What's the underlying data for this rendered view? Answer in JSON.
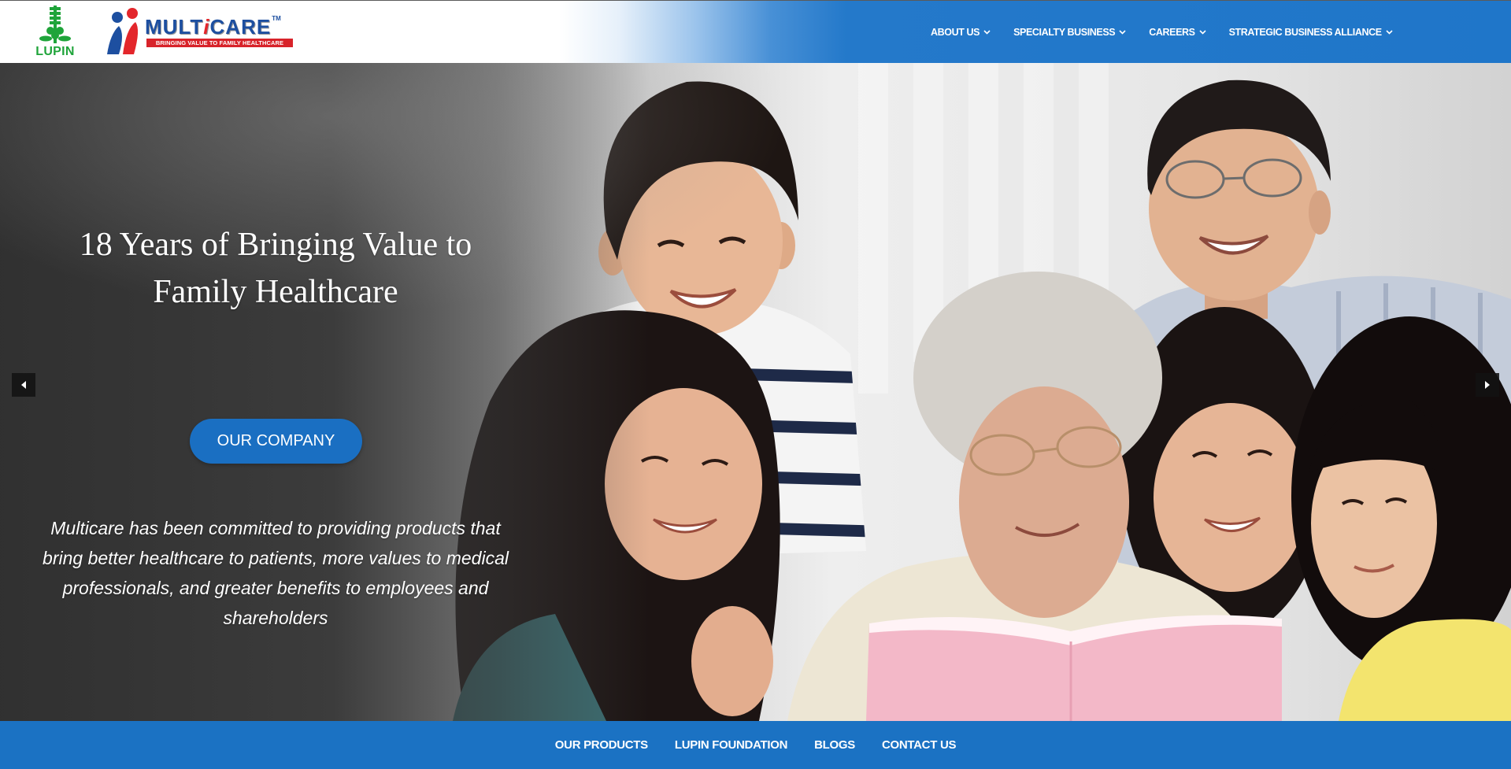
{
  "header": {
    "lupin_logo_text": "LUPIN",
    "multicare_logo": {
      "part1": "MULT",
      "part2": "i",
      "part3": "CARE",
      "tm": "TM",
      "tagline": "BRINGING VALUE TO FAMILY HEALTHCARE"
    },
    "nav": [
      {
        "label": "ABOUT US",
        "icon": "chevron-down-icon"
      },
      {
        "label": "SPECIALTY BUSINESS",
        "icon": "chevron-down-icon"
      },
      {
        "label": "CAREERS",
        "icon": "chevron-down-icon"
      },
      {
        "label": "STRATEGIC BUSINESS ALLIANCE",
        "icon": "chevron-down-icon"
      }
    ]
  },
  "hero": {
    "title_line1": "18 Years of Bringing Value to",
    "title_line2": "Family Healthcare",
    "cta_label": "OUR COMPANY",
    "description": "Multicare has been committed to providing products that bring better healthcare to patients, more values to medical professionals, and greater benefits to employees and shareholders",
    "prev_icon": "arrow-left-icon",
    "next_icon": "arrow-right-icon"
  },
  "footer_nav": [
    {
      "label": "OUR PRODUCTS"
    },
    {
      "label": "LUPIN FOUNDATION"
    },
    {
      "label": "BLOGS"
    },
    {
      "label": "CONTACT US"
    }
  ],
  "colors": {
    "brand_blue": "#1b72c3",
    "button_blue": "#1a6fc2",
    "lupin_green": "#1fa43a",
    "multicare_blue": "#1d4fa0",
    "multicare_red": "#e3262b"
  }
}
